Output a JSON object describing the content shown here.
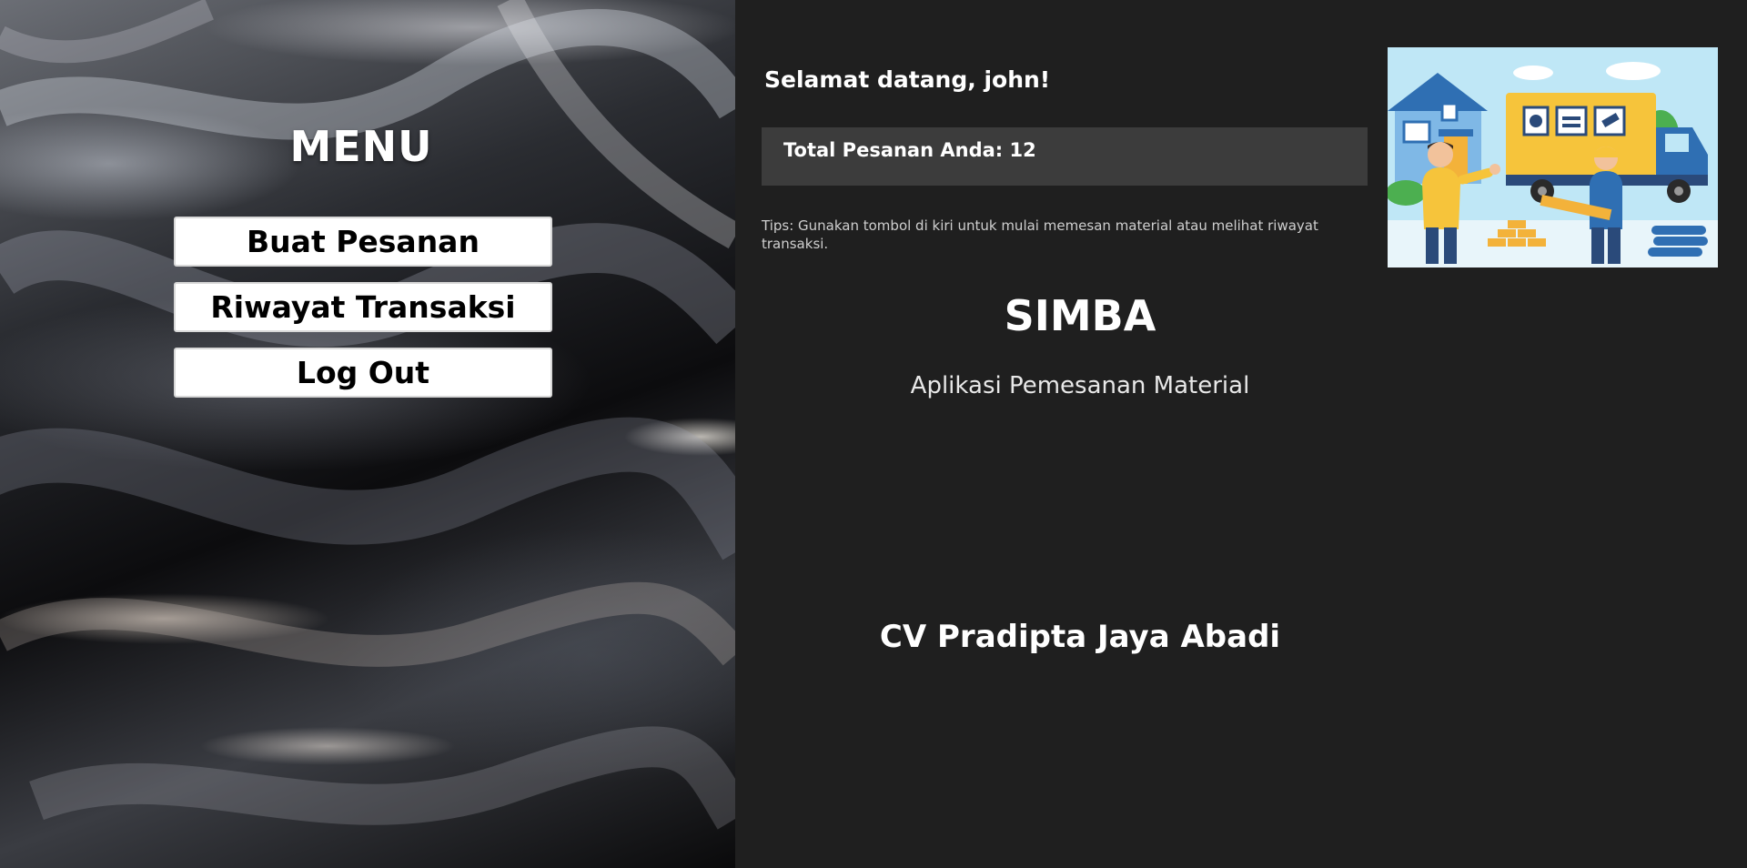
{
  "sidebar": {
    "title": "MENU",
    "buttons": {
      "buat_pesanan": "Buat Pesanan",
      "riwayat_transaksi": "Riwayat Transaksi",
      "log_out": "Log Out"
    }
  },
  "main": {
    "welcome": "Selamat datang, john!",
    "total_orders_label": "Total Pesanan Anda: 12",
    "tips": "Tips: Gunakan tombol di kiri untuk mulai memesan material atau melihat riwayat transaksi.",
    "app_name": "SIMBA",
    "app_subtitle": "Aplikasi Pemesanan Material",
    "company": "CV Pradipta Jaya Abadi"
  },
  "colors": {
    "background": "#1f1f1f",
    "total_box": "#3c3c3c",
    "button_bg": "#ffffff",
    "text": "#ffffff"
  },
  "icons": {
    "illustration": "delivery-illustration"
  }
}
